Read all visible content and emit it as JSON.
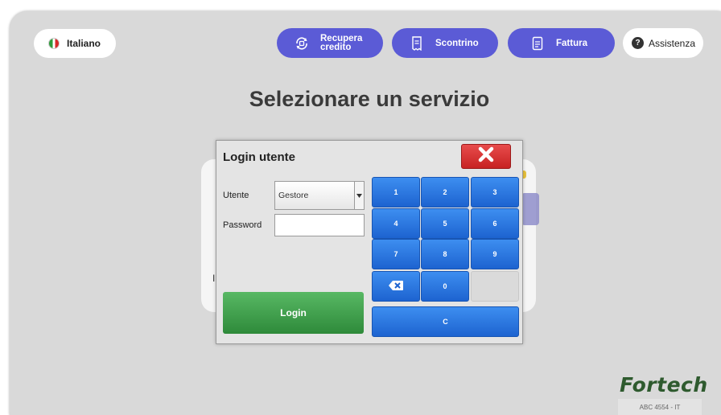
{
  "header": {
    "language_label": "Italiano",
    "nav": {
      "recupera_line1": "Recupera",
      "recupera_line2": "credito",
      "scontrino": "Scontrino",
      "fattura": "Fattura"
    },
    "help_label": "Assistenza",
    "help_icon_glyph": "?"
  },
  "main": {
    "title": "Selezionare un servizio",
    "background_letter": "I"
  },
  "login_dialog": {
    "title": "Login utente",
    "user_label": "Utente",
    "user_value": "Gestore",
    "password_label": "Password",
    "login_button": "Login",
    "keys": [
      "1",
      "2",
      "3",
      "4",
      "5",
      "6",
      "7",
      "8",
      "9",
      "0",
      "C"
    ]
  },
  "footer": {
    "brand": "Fortech",
    "machine_id": "ABC 4554 - IT"
  },
  "colors": {
    "nav_button": "#5b5bd6",
    "key": "#2a74e0",
    "close": "#d83434",
    "login": "#3f9f4a",
    "brand": "#2e5a2e"
  },
  "icons": [
    "flag-it-icon",
    "refresh-coin-icon",
    "receipt-icon",
    "invoice-icon",
    "help-icon",
    "close-x-icon",
    "backspace-icon",
    "dropdown-arrow-icon"
  ]
}
